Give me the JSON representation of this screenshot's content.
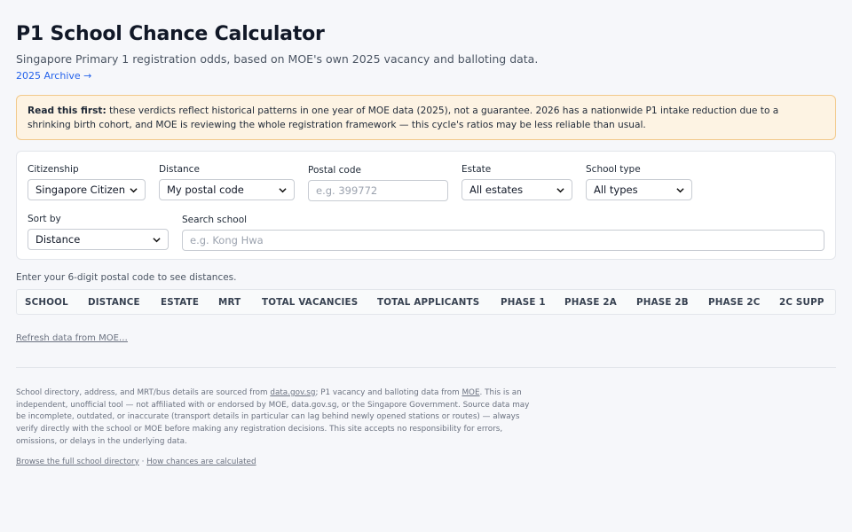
{
  "header": {
    "title": "P1 School Chance Calculator",
    "subtitle": "Singapore Primary 1 registration odds, based on MOE's own 2025 vacancy and balloting data.",
    "archive_link": "2025 Archive →"
  },
  "notice": {
    "lead": "Read this first:",
    "text": "these verdicts reflect historical patterns in one year of MOE data (2025), not a guarantee. 2026 has a nationwide P1 intake reduction due to a shrinking birth cohort, and MOE is reviewing the whole registration framework — this cycle's ratios may be less reliable than usual."
  },
  "filters": {
    "citizenship": {
      "label": "Citizenship",
      "value": "Singapore Citizen"
    },
    "distance": {
      "label": "Distance",
      "value": "My postal code"
    },
    "postal": {
      "label": "Postal code",
      "placeholder": "e.g. 399772"
    },
    "estate": {
      "label": "Estate",
      "value": "All estates"
    },
    "school_type": {
      "label": "School type",
      "value": "All types"
    },
    "sort": {
      "label": "Sort by",
      "value": "Distance"
    },
    "search": {
      "label": "Search school",
      "placeholder": "e.g. Kong Hwa"
    }
  },
  "hint": "Enter your 6-digit postal code to see distances.",
  "table": {
    "columns": [
      "SCHOOL",
      "DISTANCE",
      "ESTATE",
      "MRT",
      "TOTAL VACANCIES",
      "TOTAL APPLICANTS",
      "PHASE 1",
      "PHASE 2A",
      "PHASE 2B",
      "PHASE 2C",
      "2C SUPP"
    ]
  },
  "refresh_link": "Refresh data from MOE…",
  "footer": {
    "p1": "School directory, address, and MRT/bus details are sourced from ",
    "link_datagov": "data.gov.sg",
    "p2": "; P1 vacancy and balloting data from ",
    "link_moe": "MOE",
    "p3": ". This is an independent, unofficial tool — not affiliated with or endorsed by MOE, data.gov.sg, or the Singapore Government. Source data may be incomplete, outdated, or inaccurate (transport details in particular can lag behind newly opened stations or routes) — always verify directly with the school or MOE before making any registration decisions. This site accepts no responsibility for errors, omissions, or delays in the underlying data.",
    "link_directory": "Browse the full school directory",
    "separator": "·",
    "link_how": "How chances are calculated"
  },
  "icons": {
    "select_arrow": "chevron-down-icon"
  },
  "colors": {
    "notice_bg": "#fdf3e3",
    "notice_border": "#f2c98b",
    "link": "#2563eb"
  }
}
